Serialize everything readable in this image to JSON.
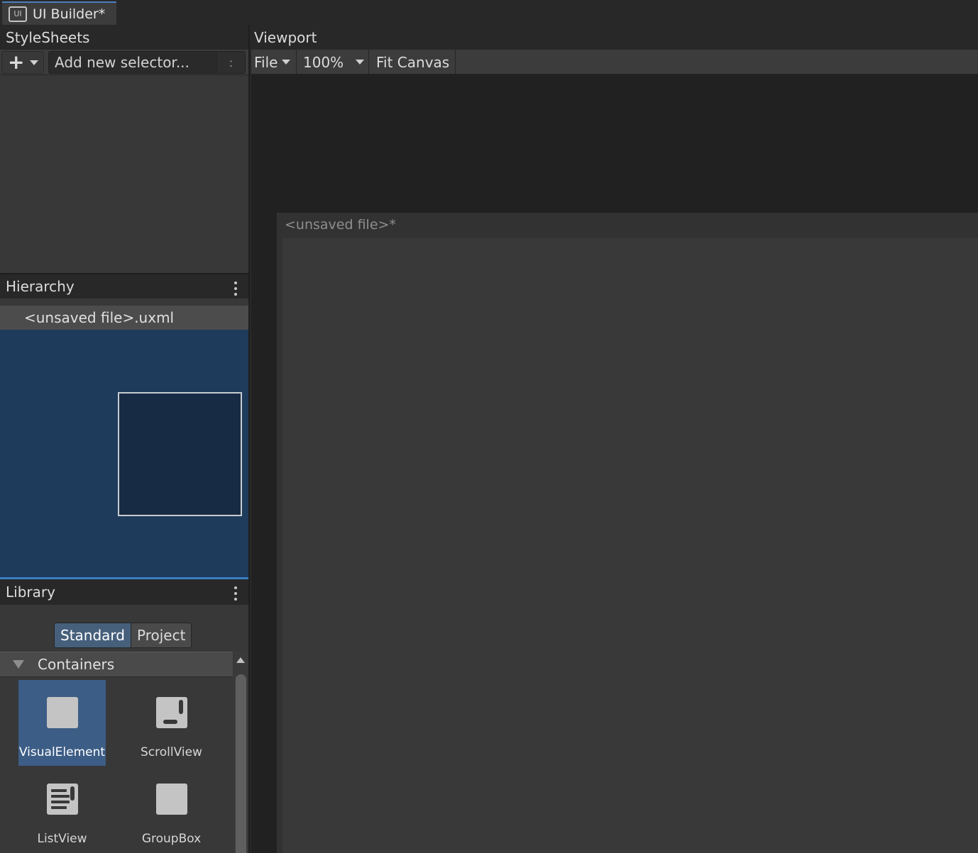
{
  "window": {
    "tab_title": "UI Builder*",
    "tab_icon": "UI"
  },
  "stylesheets": {
    "title": "StyleSheets",
    "selector_placeholder": "Add new selector...",
    "selector_suffix": ":"
  },
  "hierarchy": {
    "title": "Hierarchy",
    "root_item": "<unsaved file>.uxml"
  },
  "library": {
    "title": "Library",
    "tabs": [
      {
        "label": "Standard",
        "active": true
      },
      {
        "label": "Project",
        "active": false
      }
    ],
    "category": "Containers",
    "items": [
      {
        "label": "VisualElement",
        "icon": "visual-element-icon",
        "selected": true
      },
      {
        "label": "ScrollView",
        "icon": "scroll-view-icon",
        "selected": false
      },
      {
        "label": "ListView",
        "icon": "list-view-icon",
        "selected": false
      },
      {
        "label": "GroupBox",
        "icon": "group-box-icon",
        "selected": false
      }
    ]
  },
  "viewport": {
    "title": "Viewport",
    "file_menu": "File",
    "zoom": "100%",
    "fit_canvas": "Fit Canvas",
    "canvas_title": "<unsaved file>*"
  },
  "colors": {
    "accent": "#3a7fc4",
    "selection": "#3c5d86",
    "hierarchy_bg": "#1e3b5c"
  }
}
